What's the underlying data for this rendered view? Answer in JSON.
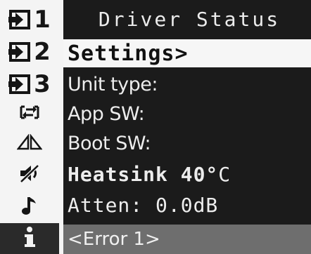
{
  "header": {
    "title": "Driver Status"
  },
  "rail": {
    "items": [
      {
        "icon": "input-arrow-icon",
        "label": "1"
      },
      {
        "icon": "input-arrow-icon",
        "label": "2"
      },
      {
        "icon": "input-arrow-icon",
        "label": "3"
      },
      {
        "icon": "swap-arrows-icon"
      },
      {
        "icon": "mirror-triangles-icon"
      },
      {
        "icon": "speaker-muted-icon"
      },
      {
        "icon": "music-note-icon"
      },
      {
        "icon": "info-icon"
      }
    ]
  },
  "menu": {
    "selected": "Settings>",
    "unit_type": "Unit type:",
    "app_sw": "App SW:",
    "boot_sw": "Boot SW:",
    "heatsink_label": "Heatsink 40°",
    "heatsink_unit": "C",
    "atten": "Atten: 0.0dB"
  },
  "status": {
    "error": "<Error 1>"
  },
  "colors": {
    "background": "#1b1b1b",
    "rail": "#f4f4f4",
    "highlight": "#f6f6f6",
    "status_bar": "#6e6e6e"
  }
}
